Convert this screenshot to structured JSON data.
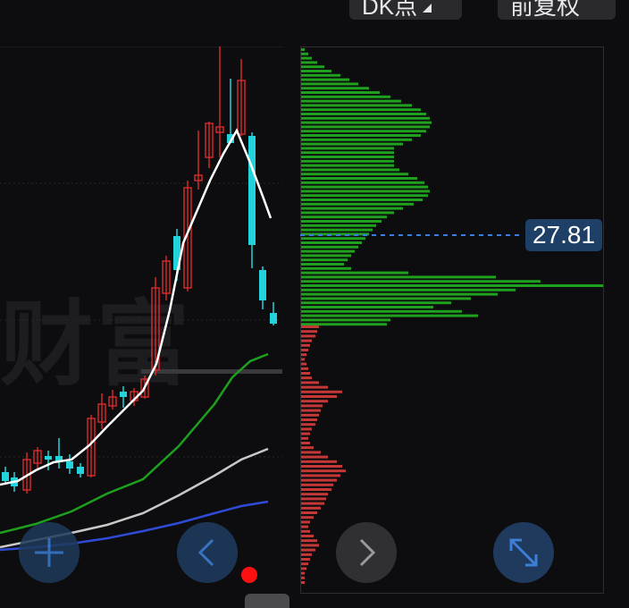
{
  "toolbar": {
    "period_label": "DK点",
    "adjust_label": "前复权"
  },
  "watermark_text": "财富",
  "price_marker": "27.81",
  "colors": {
    "background": "#0d0d0f",
    "up": "#d02a2a",
    "down": "#22d3dc",
    "ma_short": "#ffffff",
    "ma_green": "#1ea01e",
    "ma_gray": "#c8c8c8",
    "ma_blue": "#2f4bd6",
    "volume_profile_upper": "#1fa01f",
    "volume_profile_lower": "#c43838",
    "price_line": "#3b7dd8"
  },
  "icons": {
    "add": "plus-icon",
    "prev": "chevron-left-icon",
    "next": "chevron-right-icon",
    "expand": "expand-icon"
  }
}
